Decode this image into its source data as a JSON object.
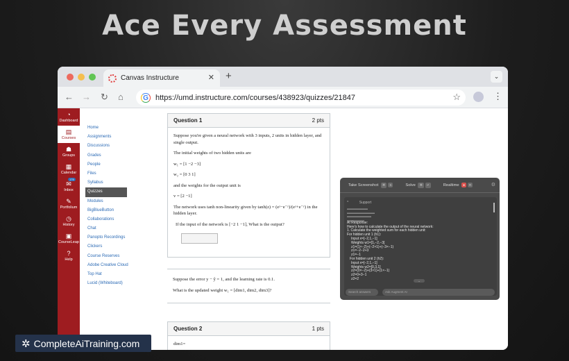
{
  "headline": "Ace Every Assessment",
  "browser": {
    "tab_title": "Canvas Instructure",
    "url": "https://umd.instructure.com/courses/438923/quizzes/21847"
  },
  "global_nav": [
    {
      "label": "Dashboard",
      "icon": "dashboard-icon",
      "glyph": "◔"
    },
    {
      "label": "Courses",
      "icon": "book-icon",
      "glyph": "▤"
    },
    {
      "label": "Groups",
      "icon": "groups-icon",
      "glyph": "☗"
    },
    {
      "label": "Calendar",
      "icon": "calendar-icon",
      "glyph": "▦"
    },
    {
      "label": "Inbox",
      "icon": "inbox-icon",
      "glyph": "✉",
      "badge": "179"
    },
    {
      "label": "Portfolium",
      "icon": "portfolium-icon",
      "glyph": "✎"
    },
    {
      "label": "History",
      "icon": "history-icon",
      "glyph": "◷"
    },
    {
      "label": "CourseLeap",
      "icon": "courseleap-icon",
      "glyph": "▣"
    },
    {
      "label": "Help",
      "icon": "help-icon",
      "glyph": "?"
    }
  ],
  "course_nav": [
    "Home",
    "Assignments",
    "Discussions",
    "Grades",
    "People",
    "Files",
    "Syllabus",
    "Quizzes",
    "Modules",
    "BigBlueButton",
    "Collaborations",
    "Chat",
    "Panopto Recordings",
    "Clickers",
    "Course Reserves",
    "Adobe Creative Cloud",
    "Top Hat",
    "Lucid (Whiteboard)"
  ],
  "question1": {
    "title": "Question 1",
    "pts": "2 pts",
    "intro": "Suppose you're given a neural network with 3 inputs, 2 units in hidden layer, and single output.",
    "weights_label": "The initial weights of two hidden units are",
    "w1": "w₁ = [1  −2  −3]",
    "w2": "w₂ = [0  3  1]",
    "out_label": "and the weights for the output unit is",
    "v": "v = [2  −1]",
    "activation": "The network uses tanh non-linearity given by tanh(z) = (eᶻ−e⁻ᶻ)/(eᶻ+e⁻ᶻ) in the hidden layer.",
    "input": "If the input of the network is [−2  1  −1], What is the output?"
  },
  "question_extra": {
    "error": "Suppose the error y − ŷ = 1, and the learning rate is 0.1.",
    "ask": "What is the updated weight w₁ = [dim1, dim2, dim3]?"
  },
  "question2": {
    "title": "Question 2",
    "pts": "1 pts",
    "answer_label": "dim1="
  },
  "ai_panel": {
    "take_screenshot": "Take Screenshot",
    "solve": "Solve",
    "realtime": "Realtime",
    "tab_label": "Support",
    "response_header": "AI Response:",
    "lines": [
      "Here's how to calculate the output of the neural network:",
      "1. Calculate the weighted sum for each hidden unit:",
      "For hidden unit 1 (h1):",
      "Input x=[−2,1,−1]",
      "Weights w1=[1,−2,−3]",
      "z1=(1×−2)+(−2×1)+(−3×−1)",
      "z1=−2−2+3",
      "z1=−1",
      "For hidden unit 2 (h2):",
      "Input x=[−2,1,−1]",
      "Weights w2=[0,3,1]",
      "z2=(0×−2)+(3×1)+(1×−1)",
      "z2=0+3−1",
      "z2=2"
    ],
    "search_placeholder": "Search answers",
    "ask_placeholder": "Ask Augment AI"
  },
  "badge": "CompleteAiTraining.com"
}
